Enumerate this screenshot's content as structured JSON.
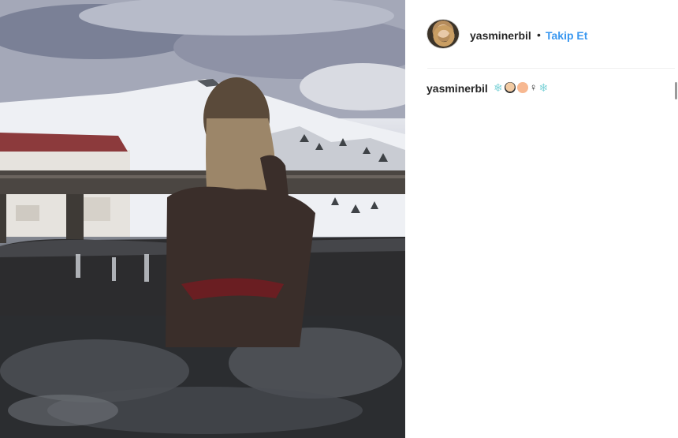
{
  "post": {
    "username": "yasminerbil",
    "separator": "•",
    "follow_label": "Takip Et"
  },
  "caption": {
    "username": "yasminerbil",
    "emojis": [
      "❄",
      "face",
      "peach",
      "♀",
      "❄"
    ]
  },
  "colors": {
    "link_blue": "#3897f0",
    "text": "#262626",
    "divider": "#efefef"
  },
  "icons": {
    "avatar": "profile-avatar"
  }
}
